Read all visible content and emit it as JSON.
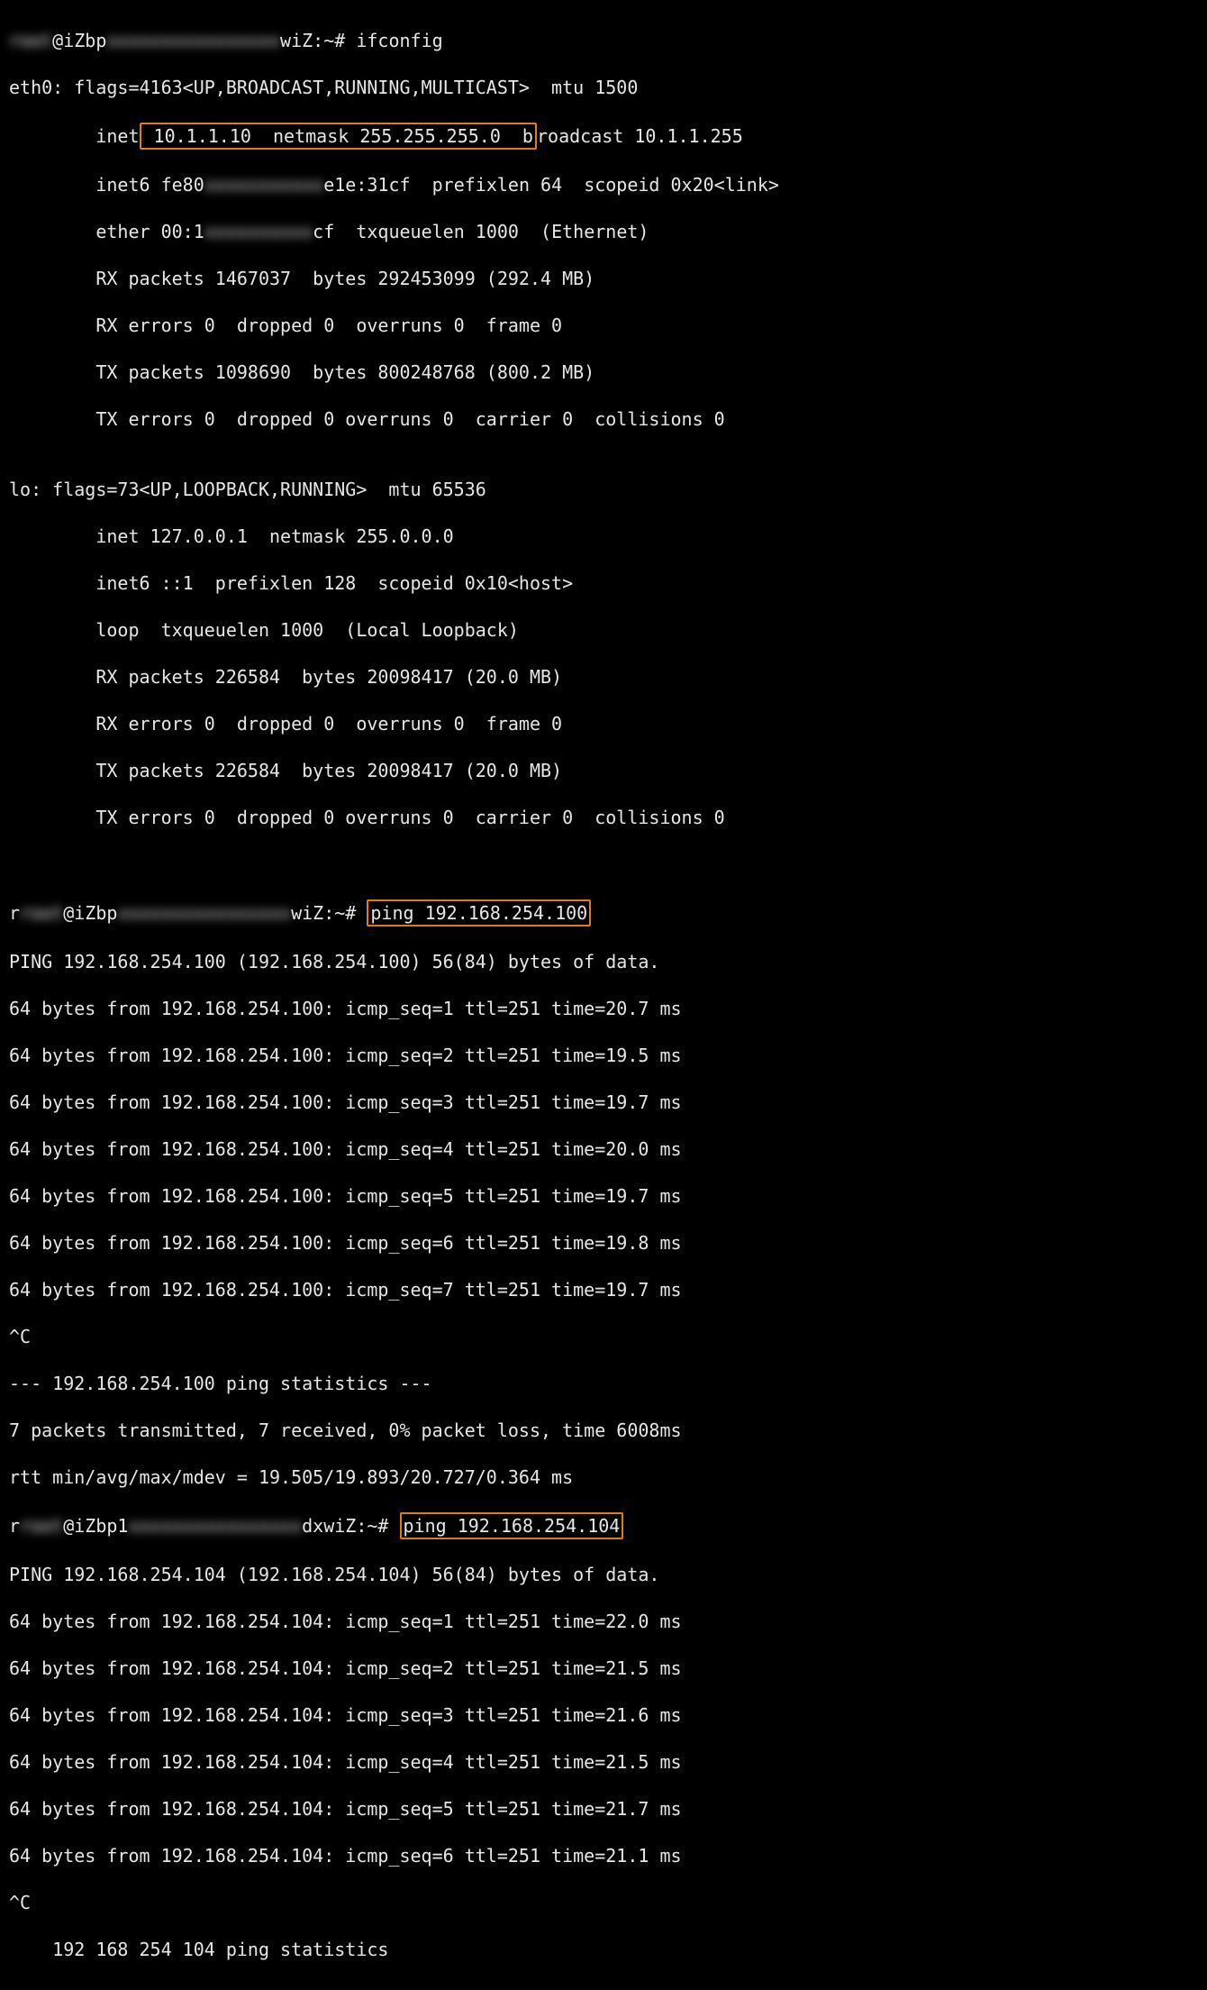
{
  "blurred": {
    "prompt1_prefix": "root",
    "prompt1_host_a": "@iZbp",
    "prompt1_host_b": "xxxxxxxxxxxxxxxx",
    "prompt1_host_c": "wiZ:~# ",
    "inet6_mid": "xxxxxxxxxxx",
    "ether_mid": "xxxxxxxxxx"
  },
  "prompts": {
    "cmd_ifconfig": "ifconfig",
    "cmd_ping1": "ping 192.168.254.100",
    "cmd_ping2": "ping 192.168.254.104",
    "prompt2_host_a": "@iZbp1",
    "prompt2_host_c": "dxwiZ:~# "
  },
  "ifconfig": {
    "eth0_header": "eth0: flags=4163<UP,BROADCAST,RUNNING,MULTICAST>  mtu 1500",
    "inet_prefix": "        inet",
    "inet_box": " 10.1.1.10  netmask 255.255.255.0  b",
    "inet_suffix": "roadcast 10.1.1.255",
    "inet6_prefix": "        inet6 fe80",
    "inet6_suffix": "e1e:31cf  prefixlen 64  scopeid 0x20<link>",
    "ether_prefix": "        ether 00:1",
    "ether_suffix": "cf  txqueuelen 1000  (Ethernet)",
    "eth0_rx_packets": "        RX packets 1467037  bytes 292453099 (292.4 MB)",
    "eth0_rx_errors": "        RX errors 0  dropped 0  overruns 0  frame 0",
    "eth0_tx_packets": "        TX packets 1098690  bytes 800248768 (800.2 MB)",
    "eth0_tx_errors": "        TX errors 0  dropped 0 overruns 0  carrier 0  collisions 0",
    "blank1": "",
    "lo_header": "lo: flags=73<UP,LOOPBACK,RUNNING>  mtu 65536",
    "lo_inet": "        inet 127.0.0.1  netmask 255.0.0.0",
    "lo_inet6": "        inet6 ::1  prefixlen 128  scopeid 0x10<host>",
    "lo_loop": "        loop  txqueuelen 1000  (Local Loopback)",
    "lo_rx_packets": "        RX packets 226584  bytes 20098417 (20.0 MB)",
    "lo_rx_errors": "        RX errors 0  dropped 0  overruns 0  frame 0",
    "lo_tx_packets": "        TX packets 226584  bytes 20098417 (20.0 MB)",
    "lo_tx_errors": "        TX errors 0  dropped 0 overruns 0  carrier 0  collisions 0"
  },
  "ping1": {
    "header": "PING 192.168.254.100 (192.168.254.100) 56(84) bytes of data.",
    "l1": "64 bytes from 192.168.254.100: icmp_seq=1 ttl=251 time=20.7 ms",
    "l2": "64 bytes from 192.168.254.100: icmp_seq=2 ttl=251 time=19.5 ms",
    "l3": "64 bytes from 192.168.254.100: icmp_seq=3 ttl=251 time=19.7 ms",
    "l4": "64 bytes from 192.168.254.100: icmp_seq=4 ttl=251 time=20.0 ms",
    "l5": "64 bytes from 192.168.254.100: icmp_seq=5 ttl=251 time=19.7 ms",
    "l6": "64 bytes from 192.168.254.100: icmp_seq=6 ttl=251 time=19.8 ms",
    "l7": "64 bytes from 192.168.254.100: icmp_seq=7 ttl=251 time=19.7 ms",
    "ctrlc": "^C",
    "stats_hdr": "--- 192.168.254.100 ping statistics ---",
    "stats1": "7 packets transmitted, 7 received, 0% packet loss, time 6008ms",
    "stats2": "rtt min/avg/max/mdev = 19.505/19.893/20.727/0.364 ms"
  },
  "ping2": {
    "header": "PING 192.168.254.104 (192.168.254.104) 56(84) bytes of data.",
    "l1": "64 bytes from 192.168.254.104: icmp_seq=1 ttl=251 time=22.0 ms",
    "l2": "64 bytes from 192.168.254.104: icmp_seq=2 ttl=251 time=21.5 ms",
    "l3": "64 bytes from 192.168.254.104: icmp_seq=3 ttl=251 time=21.6 ms",
    "l4": "64 bytes from 192.168.254.104: icmp_seq=4 ttl=251 time=21.5 ms",
    "l5": "64 bytes from 192.168.254.104: icmp_seq=5 ttl=251 time=21.7 ms",
    "l6": "64 bytes from 192.168.254.104: icmp_seq=6 ttl=251 time=21.1 ms",
    "ctrlc": "^C",
    "stats_hdr_prefix": "    192 168 254 104 ping statistics"
  }
}
